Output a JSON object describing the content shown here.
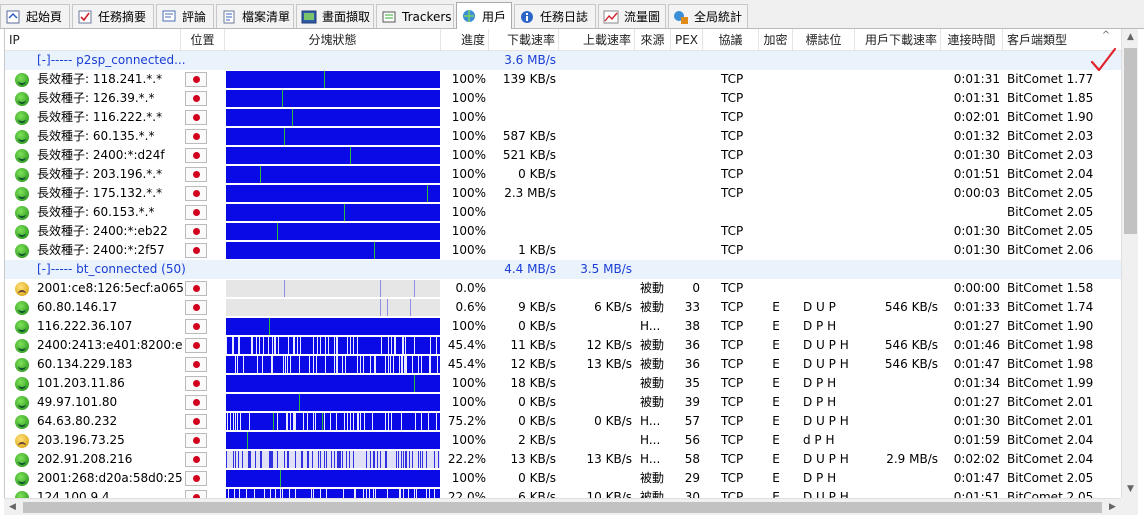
{
  "tabs": [
    {
      "label": "起始頁",
      "icon": "home-icon"
    },
    {
      "label": "任務摘要",
      "icon": "checklist-icon"
    },
    {
      "label": "評論",
      "icon": "comment-icon"
    },
    {
      "label": "檔案清單",
      "icon": "file-list-icon"
    },
    {
      "label": "畫面擷取",
      "icon": "screenshot-icon"
    },
    {
      "label": "Trackers",
      "icon": "tracker-icon"
    },
    {
      "label": "用戶",
      "icon": "globe-users-icon",
      "active": true
    },
    {
      "label": "任務日誌",
      "icon": "info-log-icon"
    },
    {
      "label": "流量圖",
      "icon": "traffic-chart-icon"
    },
    {
      "label": "全局統計",
      "icon": "global-stats-icon"
    }
  ],
  "columns": [
    "IP",
    "位置",
    "分塊狀態",
    "進度",
    "下載速率",
    "上載速率",
    "來源",
    "PEX",
    "協議",
    "加密",
    "標誌位",
    "用戶下載速率",
    "連接時間",
    "客戶端類型"
  ],
  "rows": [
    {
      "type": "group",
      "ip": "[-]----- p2sp_connected...",
      "down": "3.6 MB/s",
      "up": ""
    },
    {
      "type": "peer",
      "face": "green",
      "ip": "長效種子: 118.241.*.*",
      "blocks": {
        "base": "solid",
        "lines": [
          0.46
        ]
      },
      "progress": "100%",
      "down": "139 KB/s",
      "up": "",
      "source": "",
      "pex": "",
      "proto": "TCP",
      "enc": "",
      "flags": "",
      "peer_down": "",
      "time": "0:01:31",
      "client": "BitComet 1.77"
    },
    {
      "type": "peer",
      "face": "green",
      "ip": "長效種子: 126.39.*.*",
      "blocks": {
        "base": "solid",
        "lines": [
          0.26
        ]
      },
      "progress": "100%",
      "down": "",
      "up": "",
      "source": "",
      "pex": "",
      "proto": "TCP",
      "enc": "",
      "flags": "",
      "peer_down": "",
      "time": "0:01:31",
      "client": "BitComet 1.85"
    },
    {
      "type": "peer",
      "face": "green",
      "ip": "長效種子: 116.222.*.*",
      "blocks": {
        "base": "solid",
        "lines": [
          0.31
        ]
      },
      "progress": "100%",
      "down": "",
      "up": "",
      "source": "",
      "pex": "",
      "proto": "TCP",
      "enc": "",
      "flags": "",
      "peer_down": "",
      "time": "0:02:01",
      "client": "BitComet 1.90"
    },
    {
      "type": "peer",
      "face": "green",
      "ip": "長效種子: 60.135.*.*",
      "blocks": {
        "base": "solid",
        "lines": [
          0.27
        ]
      },
      "progress": "100%",
      "down": "587 KB/s",
      "up": "",
      "source": "",
      "pex": "",
      "proto": "TCP",
      "enc": "",
      "flags": "",
      "peer_down": "",
      "time": "0:01:32",
      "client": "BitComet 2.03"
    },
    {
      "type": "peer",
      "face": "green",
      "ip": "長效種子: 2400:*:d24f",
      "blocks": {
        "base": "solid",
        "lines": [
          0.58
        ]
      },
      "progress": "100%",
      "down": "521 KB/s",
      "up": "",
      "source": "",
      "pex": "",
      "proto": "TCP",
      "enc": "",
      "flags": "",
      "peer_down": "",
      "time": "0:01:30",
      "client": "BitComet 2.03"
    },
    {
      "type": "peer",
      "face": "green",
      "ip": "長效種子: 203.196.*.*",
      "blocks": {
        "base": "solid",
        "lines": [
          0.16
        ]
      },
      "progress": "100%",
      "down": "0 KB/s",
      "up": "",
      "source": "",
      "pex": "",
      "proto": "TCP",
      "enc": "",
      "flags": "",
      "peer_down": "",
      "time": "0:01:51",
      "client": "BitComet 2.04"
    },
    {
      "type": "peer",
      "face": "green",
      "ip": "長效種子: 175.132.*.*",
      "blocks": {
        "base": "solid",
        "lines": [
          0.94
        ]
      },
      "progress": "100%",
      "down": "2.3 MB/s",
      "up": "",
      "source": "",
      "pex": "",
      "proto": "TCP",
      "enc": "",
      "flags": "",
      "peer_down": "",
      "time": "0:00:03",
      "client": "BitComet 2.05"
    },
    {
      "type": "peer",
      "face": "green",
      "ip": "長效種子: 60.153.*.*",
      "blocks": {
        "base": "solid",
        "lines": [
          0.55
        ]
      },
      "progress": "100%",
      "down": "",
      "up": "",
      "source": "",
      "pex": "",
      "proto": "",
      "enc": "",
      "flags": "",
      "peer_down": "",
      "time": "",
      "client": "BitComet 2.05"
    },
    {
      "type": "peer",
      "face": "green",
      "ip": "長效種子: 2400:*:eb22",
      "blocks": {
        "base": "solid",
        "lines": [
          0.24
        ]
      },
      "progress": "100%",
      "down": "",
      "up": "",
      "source": "",
      "pex": "",
      "proto": "TCP",
      "enc": "",
      "flags": "",
      "peer_down": "",
      "time": "0:01:30",
      "client": "BitComet 2.05"
    },
    {
      "type": "peer",
      "face": "green",
      "ip": "長效種子: 2400:*:2f57",
      "blocks": {
        "base": "solid",
        "lines": [
          0.69
        ]
      },
      "progress": "100%",
      "down": "1 KB/s",
      "up": "",
      "source": "",
      "pex": "",
      "proto": "TCP",
      "enc": "",
      "flags": "",
      "peer_down": "",
      "time": "0:01:30",
      "client": "BitComet 2.06"
    },
    {
      "type": "group",
      "ip": "[-]----- bt_connected (50)",
      "down": "4.4 MB/s",
      "up": "3.5 MB/s"
    },
    {
      "type": "peer",
      "face": "yellow",
      "ip": "2001:ce8:126:5ecf:a065...",
      "blocks": {
        "base": "empty",
        "lines": [
          0.27,
          0.72,
          0.88
        ]
      },
      "progress": "0.0%",
      "down": "",
      "up": "",
      "source": "被動",
      "pex": "0",
      "proto": "TCP",
      "enc": "",
      "flags": "",
      "peer_down": "",
      "time": "0:00:00",
      "client": "BitComet 1.58"
    },
    {
      "type": "peer",
      "face": "green",
      "ip": "60.80.146.17",
      "blocks": {
        "base": "empty",
        "lines": [
          0.72,
          0.75,
          0.86
        ]
      },
      "progress": "0.6%",
      "down": "9 KB/s",
      "up": "6 KB/s",
      "source": "被動",
      "pex": "33",
      "proto": "TCP",
      "enc": "E",
      "flags": "D U P",
      "peer_down": "546 KB/s",
      "time": "0:01:33",
      "client": "BitComet 1.74"
    },
    {
      "type": "peer",
      "face": "green",
      "ip": "116.222.36.107",
      "blocks": {
        "base": "solid",
        "lines": [
          0.2
        ]
      },
      "progress": "100%",
      "down": "0 KB/s",
      "up": "",
      "source": "H...",
      "pex": "38",
      "proto": "TCP",
      "enc": "E",
      "flags": "D P H",
      "peer_down": "",
      "time": "0:01:27",
      "client": "BitComet 1.90"
    },
    {
      "type": "peer",
      "face": "green",
      "ip": "2400:2413:e401:8200:e...",
      "blocks": {
        "base": "striped",
        "lines": []
      },
      "progress": "45.4%",
      "down": "11 KB/s",
      "up": "12 KB/s",
      "source": "被動",
      "pex": "36",
      "proto": "TCP",
      "enc": "E",
      "flags": "D U P H",
      "peer_down": "546 KB/s",
      "time": "0:01:46",
      "client": "BitComet 1.98"
    },
    {
      "type": "peer",
      "face": "green",
      "ip": "60.134.229.183",
      "blocks": {
        "base": "striped",
        "lines": []
      },
      "progress": "45.4%",
      "down": "12 KB/s",
      "up": "13 KB/s",
      "source": "被動",
      "pex": "36",
      "proto": "TCP",
      "enc": "E",
      "flags": "D U P H",
      "peer_down": "546 KB/s",
      "time": "0:01:47",
      "client": "BitComet 1.98"
    },
    {
      "type": "peer",
      "face": "green",
      "ip": "101.203.11.86",
      "blocks": {
        "base": "solid",
        "lines": [
          0.88
        ]
      },
      "progress": "100%",
      "down": "18 KB/s",
      "up": "",
      "source": "被動",
      "pex": "35",
      "proto": "TCP",
      "enc": "E",
      "flags": "D P H",
      "peer_down": "",
      "time": "0:01:34",
      "client": "BitComet 1.99"
    },
    {
      "type": "peer",
      "face": "green",
      "ip": "49.97.101.80",
      "blocks": {
        "base": "solid",
        "lines": [
          0.34
        ]
      },
      "progress": "100%",
      "down": "0 KB/s",
      "up": "",
      "source": "被動",
      "pex": "39",
      "proto": "TCP",
      "enc": "E",
      "flags": "D P H",
      "peer_down": "",
      "time": "0:01:27",
      "client": "BitComet 2.01"
    },
    {
      "type": "peer",
      "face": "green",
      "ip": "64.63.80.232",
      "blocks": {
        "base": "striped",
        "lines": [
          0.22,
          0.45
        ]
      },
      "progress": "75.2%",
      "down": "0 KB/s",
      "up": "0 KB/s",
      "source": "H...",
      "pex": "57",
      "proto": "TCP",
      "enc": "E",
      "flags": "D U P H",
      "peer_down": "",
      "time": "0:01:30",
      "client": "BitComet 2.01"
    },
    {
      "type": "peer",
      "face": "yellow",
      "ip": "203.196.73.25",
      "blocks": {
        "base": "solid",
        "lines": [
          0.1
        ]
      },
      "progress": "100%",
      "down": "2 KB/s",
      "up": "",
      "source": "H...",
      "pex": "56",
      "proto": "TCP",
      "enc": "E",
      "flags": "d P H",
      "peer_down": "",
      "time": "0:01:59",
      "client": "BitComet 2.04"
    },
    {
      "type": "peer",
      "face": "green",
      "ip": "202.91.208.216",
      "blocks": {
        "base": "striped-light",
        "lines": []
      },
      "progress": "22.2%",
      "down": "13 KB/s",
      "up": "13 KB/s",
      "source": "H...",
      "pex": "58",
      "proto": "TCP",
      "enc": "E",
      "flags": "D U P H",
      "peer_down": "2.9 MB/s",
      "time": "0:02:02",
      "client": "BitComet 2.04"
    },
    {
      "type": "peer",
      "face": "green",
      "ip": "2001:268:d20a:58d0:25...",
      "blocks": {
        "base": "solid",
        "lines": [
          0.25
        ]
      },
      "progress": "100%",
      "down": "0 KB/s",
      "up": "",
      "source": "被動",
      "pex": "29",
      "proto": "TCP",
      "enc": "E",
      "flags": "D P H",
      "peer_down": "",
      "time": "0:01:47",
      "client": "BitComet 2.05"
    },
    {
      "type": "peer",
      "face": "green",
      "ip": "124.100.9.4",
      "blocks": {
        "base": "striped",
        "lines": []
      },
      "progress": "22.0%",
      "down": "6 KB/s",
      "up": "10 KB/s",
      "source": "被動",
      "pex": "30",
      "proto": "TCP",
      "enc": "E",
      "flags": "D U P H",
      "peer_down": "",
      "time": "0:01:51",
      "client": "BitComet 2.05"
    }
  ],
  "colors": {
    "block_blue": "#0a0ae6",
    "block_line": "#2bbd3a",
    "empty_bg": "#e6e6e6",
    "group_text": "#1a3dd6",
    "group_bg": "#eaf3fb",
    "checkmark": "#e0242a"
  },
  "decor": {
    "checkmark": "checkmark-icon"
  }
}
